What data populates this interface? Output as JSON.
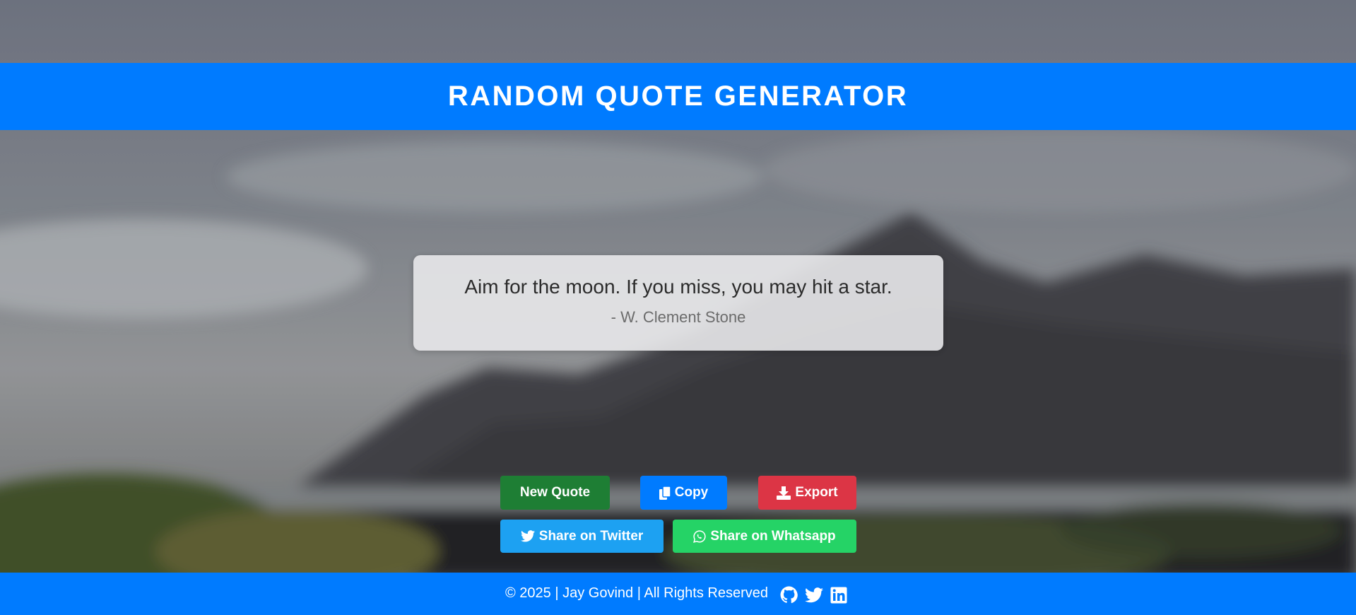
{
  "header": {
    "title": "RANDOM QUOTE GENERATOR"
  },
  "quote": {
    "text": "Aim for the moon. If you miss, you may hit a star.",
    "author": "- W. Clement Stone"
  },
  "buttons": {
    "new_quote": "New Quote",
    "copy": "Copy",
    "export": "Export",
    "share_twitter": "Share on Twitter",
    "share_whatsapp": "Share on Whatsapp"
  },
  "footer": {
    "text": "© 2025 | Jay Govind | All Rights Reserved",
    "icons": [
      "github-icon",
      "twitter-icon",
      "linkedin-icon"
    ]
  },
  "colors": {
    "primary": "#007bff",
    "new_quote": "#1e7e34",
    "export": "#dc3545",
    "twitter": "#1da1f2",
    "whatsapp": "#25d366"
  }
}
